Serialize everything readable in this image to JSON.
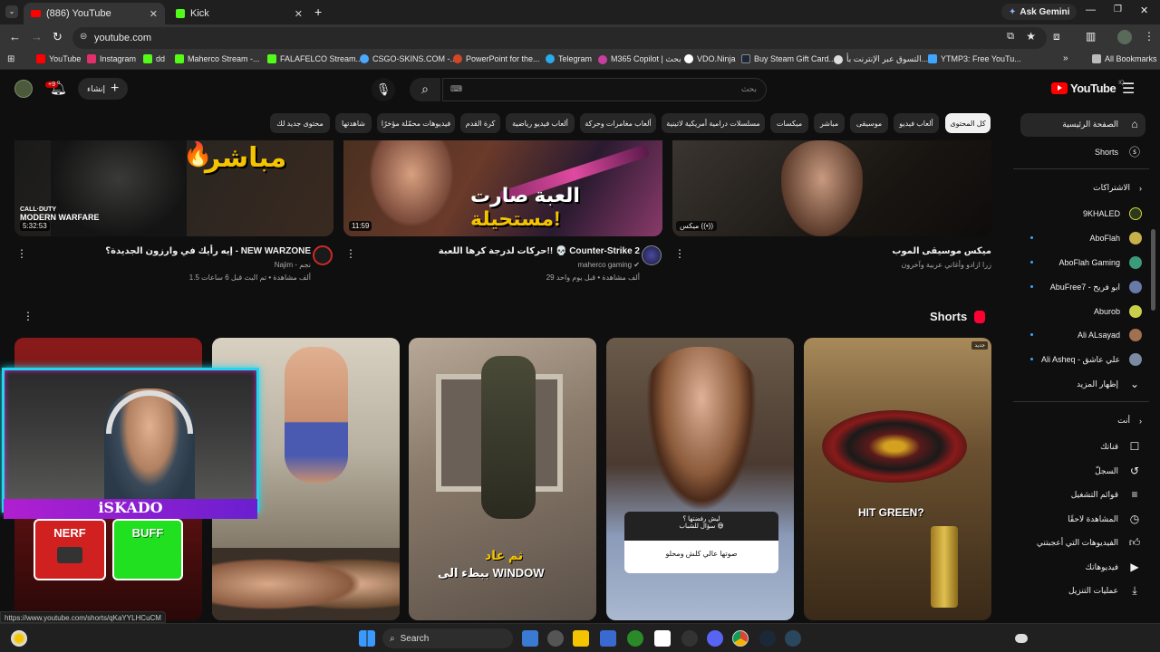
{
  "browser": {
    "tabs": [
      {
        "title": "(886) YouTube",
        "active": true
      },
      {
        "title": "Kick",
        "active": false
      }
    ],
    "new_tab": "+",
    "ask_gemini": "Ask Gemini",
    "url": "youtube.com",
    "bookmarks": [
      {
        "label": "YouTube",
        "color": "#ff0000"
      },
      {
        "label": "Instagram",
        "color": "#e1306c"
      },
      {
        "label": "dd",
        "color": "#53fc18"
      },
      {
        "label": "Maherco Stream -...",
        "color": "#53fc18"
      },
      {
        "label": "FALAFELCO Stream...",
        "color": "#53fc18"
      },
      {
        "label": "CSGO-SKINS.COM -...",
        "color": "#4aa8ff"
      },
      {
        "label": "PowerPoint for the...",
        "color": "#d24726"
      },
      {
        "label": "Telegram",
        "color": "#2aabee"
      },
      {
        "label": "M365 Copilot | بحث",
        "color": "#c83f9e"
      },
      {
        "label": "VDO.Ninja",
        "color": "#ffffff"
      },
      {
        "label": "Buy Steam Gift Card...",
        "color": "#1b2838"
      },
      {
        "label": "التسوق عبر الإنترنت بأ...",
        "color": "#dddddd"
      },
      {
        "label": "YTMP3: Free YouTu...",
        "color": "#3ea6ff"
      }
    ],
    "all_bookmarks": "All Bookmarks"
  },
  "youtube": {
    "logo": "YouTube",
    "logo_region": "IQ",
    "search_placeholder": "بحث",
    "create_label": "إنشاء",
    "notifications_badge": "+9",
    "chips": [
      "كل المحتوى",
      "ألعاب فيديو",
      "موسيقى",
      "مباشر",
      "ميكسات",
      "مسلسلات درامية أمريكية لاتينية",
      "ألعاب مغامرات وحركة",
      "ألعاب فيديو رياضية",
      "كرة القدم",
      "فيديوهات محمّلة مؤخرًا",
      "شاهدتها",
      "محتوى جديد لك"
    ],
    "videos": [
      {
        "title": "ميكس موسيقى الموب",
        "meta1": "زرا ازادو وأغاني عربية وآخرون",
        "meta2": "",
        "thumb_text": "",
        "badge": "ميكس",
        "duration": ""
      },
      {
        "title": "حركات لدرجة كرها اللعبة!! 💀 Counter-Strike 2",
        "channel": "maherco gaming",
        "meta2": "29 ألف مشاهدة • قبل يوم واحد",
        "thumb_text_1": "العبة صارت",
        "thumb_text_2": "مستحيلة!",
        "duration": "11:59"
      },
      {
        "title": "إيه رأيك في وارزون الجديدة؟ - NEW WARZONE",
        "channel": "Najim - نجم",
        "meta2": "1.5 ألف مشاهدة • تم البث قبل 6 ساعات",
        "thumb_text": "مباشر",
        "game_logo_1": "CALL·DUTY",
        "game_logo_2": "MODERN WARFARE",
        "duration": "5:32:53"
      }
    ],
    "shorts_title": "Shorts",
    "shorts": [
      {
        "overlay": "HIT GREEN?",
        "corner": "جديد"
      },
      {
        "overlay_top": "ليش رفضتها ؟\nسؤال للشباب 😅",
        "overlay_bottom": "صوتها عالي كلش ومحلو"
      },
      {
        "overlay_1": "ثم عاد",
        "overlay_2": "ببطء الى WINDOW"
      },
      {
        "overlay": ""
      },
      {
        "overlay": ""
      }
    ],
    "sidebar": {
      "home": "الصفحة الرئيسية",
      "shorts": "Shorts",
      "subscriptions": "الاشتراكات",
      "channels": [
        {
          "name": "9KHALED",
          "color": "#2b3a1a",
          "dot": false
        },
        {
          "name": "AboFlah",
          "color": "#c8b04a",
          "dot": true
        },
        {
          "name": "AboFlah Gaming",
          "color": "#3a9a7a",
          "dot": true
        },
        {
          "name": "AbuFree7 - ابو فريح",
          "color": "#6a7aa8",
          "dot": true
        },
        {
          "name": "Aburob",
          "color": "#c8d04a",
          "dot": false
        },
        {
          "name": "Ali ALsayad",
          "color": "#a07050",
          "dot": true
        },
        {
          "name": "Ali Asheq - علي عاشق",
          "color": "#7a8aa0",
          "dot": true
        }
      ],
      "show_more": "إظهار المزيد",
      "you": "أنت",
      "you_items": [
        "قناتك",
        "السجلّ",
        "قوائم التشغيل",
        "المشاهدة لاحقًا",
        "الفيديوهات التي أعجبتني",
        "فيديوهاتك",
        "عمليات التنزيل"
      ]
    },
    "overlay_streamer": "iSKADO",
    "nerf": "NERF",
    "buff": "BUFF"
  },
  "status_url": "https://www.youtube.com/shorts/qKaYYLHCuCM",
  "taskbar": {
    "search": "Search"
  }
}
